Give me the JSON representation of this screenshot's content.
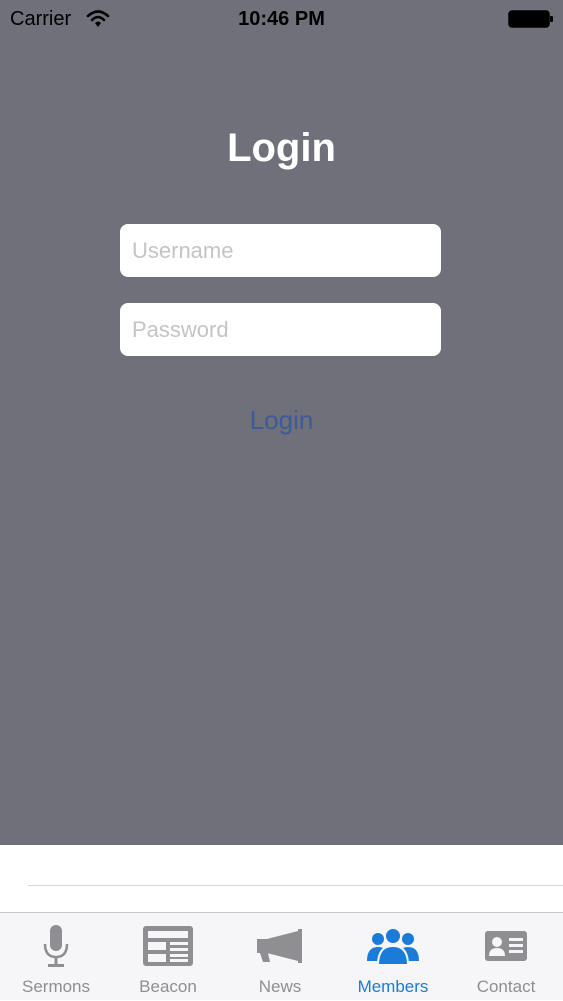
{
  "status_bar": {
    "carrier": "Carrier",
    "time": "10:46 PM"
  },
  "login": {
    "title": "Login",
    "username_placeholder": "Username",
    "password_placeholder": "Password",
    "button_label": "Login"
  },
  "tabs": [
    {
      "label": "Sermons",
      "icon": "microphone-icon",
      "active": false
    },
    {
      "label": "Beacon",
      "icon": "newspaper-icon",
      "active": false
    },
    {
      "label": "News",
      "icon": "megaphone-icon",
      "active": false
    },
    {
      "label": "Members",
      "icon": "members-icon",
      "active": true
    },
    {
      "label": "Contact",
      "icon": "contact-card-icon",
      "active": false
    }
  ],
  "colors": {
    "overlay": "#6f7079",
    "active_tab": "#1a7bd8",
    "inactive_tab": "#8e8e93",
    "login_button": "#3c5b98"
  }
}
